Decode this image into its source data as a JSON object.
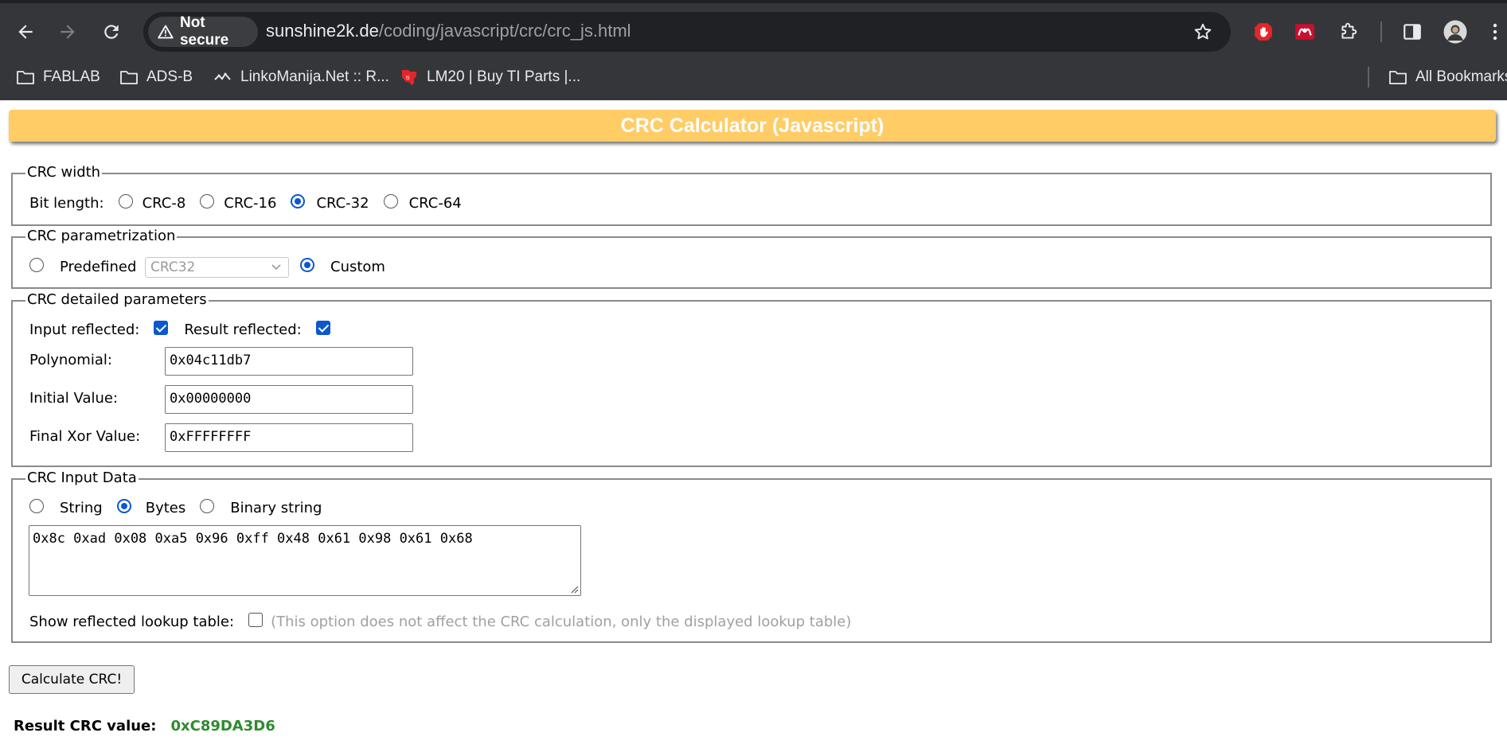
{
  "browser": {
    "security_label": "Not secure",
    "url_host": "sunshine2k.de",
    "url_path": "/coding/javascript/crc/crc_js.html",
    "bookmarks": [
      {
        "label": "FABLAB",
        "icon": "folder-icon"
      },
      {
        "label": "ADS-B",
        "icon": "folder-icon"
      },
      {
        "label": "LinkoManija.Net :: R...",
        "icon": "site-favicon"
      },
      {
        "label": "LM20 | Buy TI Parts |...",
        "icon": "ti-favicon"
      }
    ],
    "all_bookmarks_label": "All Bookmarks"
  },
  "page": {
    "title": "CRC Calculator (Javascript)",
    "width_section": {
      "legend": "CRC width",
      "bit_length_label": "Bit length:",
      "options": [
        "CRC-8",
        "CRC-16",
        "CRC-32",
        "CRC-64"
      ],
      "selected": "CRC-32"
    },
    "param_section": {
      "legend": "CRC parametrization",
      "predefined_label": "Predefined",
      "predefined_value": "CRC32",
      "custom_label": "Custom",
      "selected": "Custom"
    },
    "detail_section": {
      "legend": "CRC detailed parameters",
      "input_reflected_label": "Input reflected:",
      "input_reflected": true,
      "result_reflected_label": "Result reflected:",
      "result_reflected": true,
      "polynomial_label": "Polynomial:",
      "polynomial_value": "0x04c11db7",
      "initial_label": "Initial Value:",
      "initial_value": "0x00000000",
      "final_xor_label": "Final Xor Value:",
      "final_xor_value": "0xFFFFFFFF"
    },
    "input_section": {
      "legend": "CRC Input Data",
      "options": [
        "String",
        "Bytes",
        "Binary string"
      ],
      "selected": "Bytes",
      "data": "0x8c 0xad 0x08 0xa5 0x96 0xff 0x48 0x61 0x98 0x61 0x68",
      "show_reflected_label": "Show reflected lookup table:",
      "show_reflected": false,
      "note": "(This option does not affect the CRC calculation, only the displayed lookup table)"
    },
    "calculate_button": "Calculate CRC!",
    "result_label": "Result CRC value:",
    "result_value": "0xC89DA3D6"
  },
  "colors": {
    "title_bar": "#ffcc66",
    "accent": "#0b57d0",
    "result": "#2e8b2e"
  }
}
